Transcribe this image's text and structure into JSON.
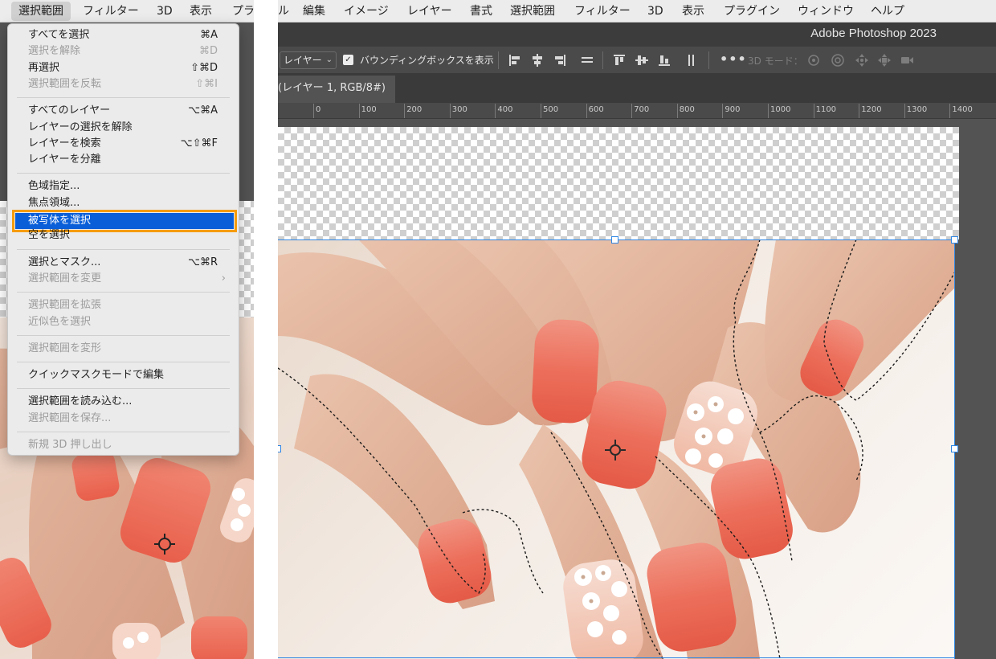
{
  "left_menubar": {
    "items": [
      "選択範囲",
      "フィルター",
      "3D",
      "表示",
      "プラ"
    ]
  },
  "select_menu": {
    "groups": [
      [
        {
          "label": "すべてを選択",
          "shortcut": "⌘A",
          "enabled": true
        },
        {
          "label": "選択を解除",
          "shortcut": "⌘D",
          "enabled": false
        },
        {
          "label": "再選択",
          "shortcut": "⇧⌘D",
          "enabled": true
        },
        {
          "label": "選択範囲を反転",
          "shortcut": "⇧⌘I",
          "enabled": false
        }
      ],
      [
        {
          "label": "すべてのレイヤー",
          "shortcut": "⌥⌘A",
          "enabled": true
        },
        {
          "label": "レイヤーの選択を解除",
          "shortcut": "",
          "enabled": true
        },
        {
          "label": "レイヤーを検索",
          "shortcut": "⌥⇧⌘F",
          "enabled": true
        },
        {
          "label": "レイヤーを分離",
          "shortcut": "",
          "enabled": true
        }
      ],
      [
        {
          "label": "色域指定...",
          "shortcut": "",
          "enabled": true
        },
        {
          "label": "焦点領域...",
          "shortcut": "",
          "enabled": true
        },
        {
          "label": "被写体を選択",
          "shortcut": "",
          "enabled": true,
          "highlighted": true
        },
        {
          "label": "空を選択",
          "shortcut": "",
          "enabled": true
        }
      ],
      [
        {
          "label": "選択とマスク...",
          "shortcut": "⌥⌘R",
          "enabled": true
        },
        {
          "label": "選択範囲を変更",
          "shortcut": "",
          "enabled": false,
          "submenu": true
        }
      ],
      [
        {
          "label": "選択範囲を拡張",
          "shortcut": "",
          "enabled": false
        },
        {
          "label": "近似色を選択",
          "shortcut": "",
          "enabled": false
        }
      ],
      [
        {
          "label": "選択範囲を変形",
          "shortcut": "",
          "enabled": false
        }
      ],
      [
        {
          "label": "クイックマスクモードで編集",
          "shortcut": "",
          "enabled": true
        }
      ],
      [
        {
          "label": "選択範囲を読み込む...",
          "shortcut": "",
          "enabled": true
        },
        {
          "label": "選択範囲を保存...",
          "shortcut": "",
          "enabled": false
        }
      ],
      [
        {
          "label": "新規 3D 押し出し",
          "shortcut": "",
          "enabled": false
        }
      ]
    ]
  },
  "right_menubar": {
    "items": [
      "ル",
      "編集",
      "イメージ",
      "レイヤー",
      "書式",
      "選択範囲",
      "フィルター",
      "3D",
      "表示",
      "プラグイン",
      "ウィンドウ",
      "ヘルプ"
    ]
  },
  "app_title": "Adobe Photoshop 2023",
  "options_bar": {
    "auto_select_target": "レイヤー",
    "show_transform_controls_checked": true,
    "show_transform_controls_label": "バウンディングボックスを表示",
    "more_label": "•••",
    "mode_3d_label": "3D モード："
  },
  "document_tab": {
    "label": "(レイヤー 1, RGB/8#)"
  },
  "ruler": {
    "labels": [
      "0",
      "100",
      "200",
      "300",
      "400",
      "500",
      "600",
      "700",
      "800",
      "900",
      "1000",
      "1100",
      "1200",
      "1300",
      "1400"
    ]
  },
  "icons": {
    "check": "checkmark-icon",
    "chevron": "chevron-down-icon"
  },
  "colors": {
    "menu_highlight": "#0a5fd9",
    "highlight_outline": "#f59c0b",
    "bounding_box": "#2f86e3",
    "nail_color": "#e8705c"
  }
}
